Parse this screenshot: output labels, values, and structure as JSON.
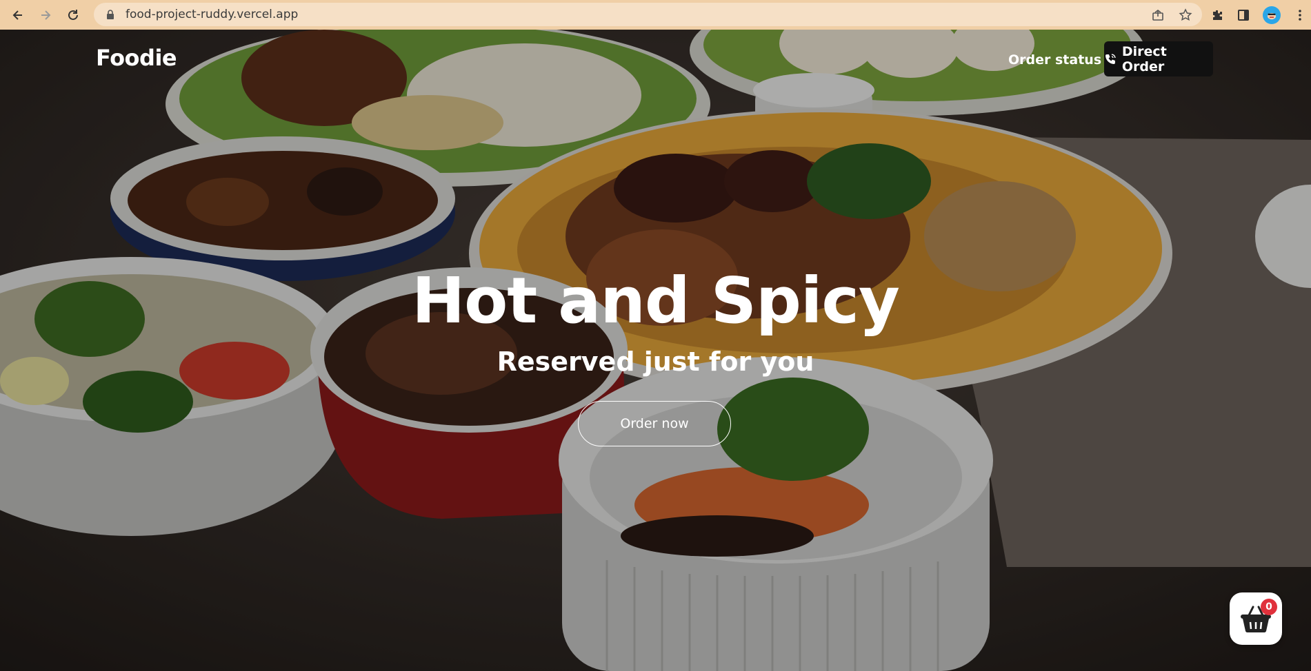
{
  "browser": {
    "url": "food-project-ruddy.vercel.app",
    "icons": [
      "back-arrow-icon",
      "forward-arrow-icon",
      "reload-icon",
      "lock-icon",
      "share-icon",
      "star-icon",
      "extensions-icon",
      "sidepanel-icon",
      "profile-avatar",
      "kebab-menu-icon"
    ]
  },
  "header": {
    "brand": "Foodie",
    "order_status": "Order status",
    "direct_order": "Direct Order"
  },
  "hero": {
    "title": "Hot and Spicy",
    "subtitle": "Reserved just for you",
    "cta": "Order now"
  },
  "cart": {
    "count": "0"
  },
  "colors": {
    "chrome_bar": "#f0cfa6",
    "direct_order_bg": "#111111",
    "badge": "#e0313c"
  }
}
